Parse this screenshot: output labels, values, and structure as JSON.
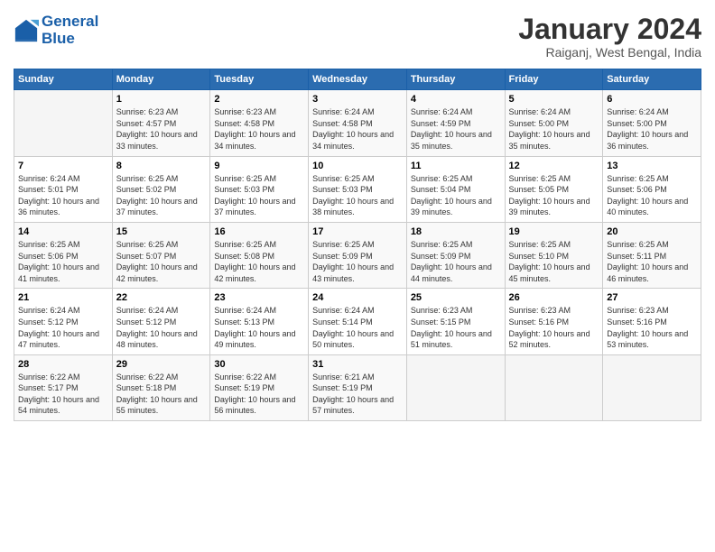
{
  "header": {
    "logo_line1": "General",
    "logo_line2": "Blue",
    "month_title": "January 2024",
    "subtitle": "Raiganj, West Bengal, India"
  },
  "weekdays": [
    "Sunday",
    "Monday",
    "Tuesday",
    "Wednesday",
    "Thursday",
    "Friday",
    "Saturday"
  ],
  "weeks": [
    [
      {
        "day": "",
        "sunrise": "",
        "sunset": "",
        "daylight": ""
      },
      {
        "day": "1",
        "sunrise": "Sunrise: 6:23 AM",
        "sunset": "Sunset: 4:57 PM",
        "daylight": "Daylight: 10 hours and 33 minutes."
      },
      {
        "day": "2",
        "sunrise": "Sunrise: 6:23 AM",
        "sunset": "Sunset: 4:58 PM",
        "daylight": "Daylight: 10 hours and 34 minutes."
      },
      {
        "day": "3",
        "sunrise": "Sunrise: 6:24 AM",
        "sunset": "Sunset: 4:58 PM",
        "daylight": "Daylight: 10 hours and 34 minutes."
      },
      {
        "day": "4",
        "sunrise": "Sunrise: 6:24 AM",
        "sunset": "Sunset: 4:59 PM",
        "daylight": "Daylight: 10 hours and 35 minutes."
      },
      {
        "day": "5",
        "sunrise": "Sunrise: 6:24 AM",
        "sunset": "Sunset: 5:00 PM",
        "daylight": "Daylight: 10 hours and 35 minutes."
      },
      {
        "day": "6",
        "sunrise": "Sunrise: 6:24 AM",
        "sunset": "Sunset: 5:00 PM",
        "daylight": "Daylight: 10 hours and 36 minutes."
      }
    ],
    [
      {
        "day": "7",
        "sunrise": "Sunrise: 6:24 AM",
        "sunset": "Sunset: 5:01 PM",
        "daylight": "Daylight: 10 hours and 36 minutes."
      },
      {
        "day": "8",
        "sunrise": "Sunrise: 6:25 AM",
        "sunset": "Sunset: 5:02 PM",
        "daylight": "Daylight: 10 hours and 37 minutes."
      },
      {
        "day": "9",
        "sunrise": "Sunrise: 6:25 AM",
        "sunset": "Sunset: 5:03 PM",
        "daylight": "Daylight: 10 hours and 37 minutes."
      },
      {
        "day": "10",
        "sunrise": "Sunrise: 6:25 AM",
        "sunset": "Sunset: 5:03 PM",
        "daylight": "Daylight: 10 hours and 38 minutes."
      },
      {
        "day": "11",
        "sunrise": "Sunrise: 6:25 AM",
        "sunset": "Sunset: 5:04 PM",
        "daylight": "Daylight: 10 hours and 39 minutes."
      },
      {
        "day": "12",
        "sunrise": "Sunrise: 6:25 AM",
        "sunset": "Sunset: 5:05 PM",
        "daylight": "Daylight: 10 hours and 39 minutes."
      },
      {
        "day": "13",
        "sunrise": "Sunrise: 6:25 AM",
        "sunset": "Sunset: 5:06 PM",
        "daylight": "Daylight: 10 hours and 40 minutes."
      }
    ],
    [
      {
        "day": "14",
        "sunrise": "Sunrise: 6:25 AM",
        "sunset": "Sunset: 5:06 PM",
        "daylight": "Daylight: 10 hours and 41 minutes."
      },
      {
        "day": "15",
        "sunrise": "Sunrise: 6:25 AM",
        "sunset": "Sunset: 5:07 PM",
        "daylight": "Daylight: 10 hours and 42 minutes."
      },
      {
        "day": "16",
        "sunrise": "Sunrise: 6:25 AM",
        "sunset": "Sunset: 5:08 PM",
        "daylight": "Daylight: 10 hours and 42 minutes."
      },
      {
        "day": "17",
        "sunrise": "Sunrise: 6:25 AM",
        "sunset": "Sunset: 5:09 PM",
        "daylight": "Daylight: 10 hours and 43 minutes."
      },
      {
        "day": "18",
        "sunrise": "Sunrise: 6:25 AM",
        "sunset": "Sunset: 5:09 PM",
        "daylight": "Daylight: 10 hours and 44 minutes."
      },
      {
        "day": "19",
        "sunrise": "Sunrise: 6:25 AM",
        "sunset": "Sunset: 5:10 PM",
        "daylight": "Daylight: 10 hours and 45 minutes."
      },
      {
        "day": "20",
        "sunrise": "Sunrise: 6:25 AM",
        "sunset": "Sunset: 5:11 PM",
        "daylight": "Daylight: 10 hours and 46 minutes."
      }
    ],
    [
      {
        "day": "21",
        "sunrise": "Sunrise: 6:24 AM",
        "sunset": "Sunset: 5:12 PM",
        "daylight": "Daylight: 10 hours and 47 minutes."
      },
      {
        "day": "22",
        "sunrise": "Sunrise: 6:24 AM",
        "sunset": "Sunset: 5:12 PM",
        "daylight": "Daylight: 10 hours and 48 minutes."
      },
      {
        "day": "23",
        "sunrise": "Sunrise: 6:24 AM",
        "sunset": "Sunset: 5:13 PM",
        "daylight": "Daylight: 10 hours and 49 minutes."
      },
      {
        "day": "24",
        "sunrise": "Sunrise: 6:24 AM",
        "sunset": "Sunset: 5:14 PM",
        "daylight": "Daylight: 10 hours and 50 minutes."
      },
      {
        "day": "25",
        "sunrise": "Sunrise: 6:23 AM",
        "sunset": "Sunset: 5:15 PM",
        "daylight": "Daylight: 10 hours and 51 minutes."
      },
      {
        "day": "26",
        "sunrise": "Sunrise: 6:23 AM",
        "sunset": "Sunset: 5:16 PM",
        "daylight": "Daylight: 10 hours and 52 minutes."
      },
      {
        "day": "27",
        "sunrise": "Sunrise: 6:23 AM",
        "sunset": "Sunset: 5:16 PM",
        "daylight": "Daylight: 10 hours and 53 minutes."
      }
    ],
    [
      {
        "day": "28",
        "sunrise": "Sunrise: 6:22 AM",
        "sunset": "Sunset: 5:17 PM",
        "daylight": "Daylight: 10 hours and 54 minutes."
      },
      {
        "day": "29",
        "sunrise": "Sunrise: 6:22 AM",
        "sunset": "Sunset: 5:18 PM",
        "daylight": "Daylight: 10 hours and 55 minutes."
      },
      {
        "day": "30",
        "sunrise": "Sunrise: 6:22 AM",
        "sunset": "Sunset: 5:19 PM",
        "daylight": "Daylight: 10 hours and 56 minutes."
      },
      {
        "day": "31",
        "sunrise": "Sunrise: 6:21 AM",
        "sunset": "Sunset: 5:19 PM",
        "daylight": "Daylight: 10 hours and 57 minutes."
      },
      {
        "day": "",
        "sunrise": "",
        "sunset": "",
        "daylight": ""
      },
      {
        "day": "",
        "sunrise": "",
        "sunset": "",
        "daylight": ""
      },
      {
        "day": "",
        "sunrise": "",
        "sunset": "",
        "daylight": ""
      }
    ]
  ]
}
